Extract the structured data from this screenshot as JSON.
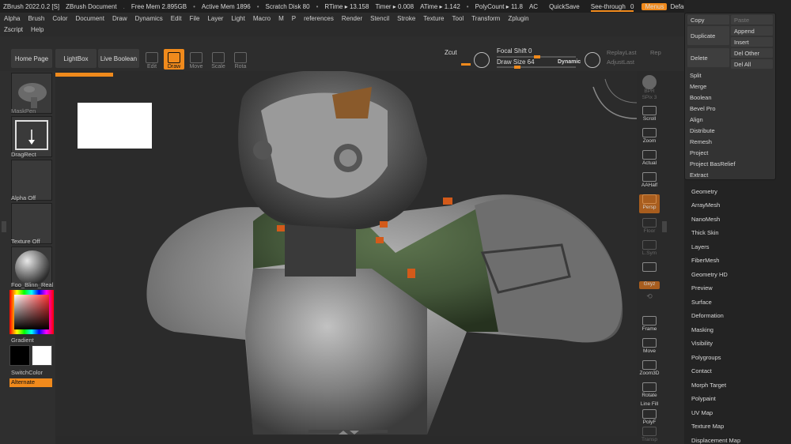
{
  "titlebar": {
    "app": "ZBrush 2022.0.2 [S]",
    "doc": "ZBrush Document",
    "free_mem": "Free Mem 2.895GB",
    "active_mem": "Active Mem 1896",
    "scratch": "Scratch Disk 80",
    "rtime": "RTime ▸ 13.158",
    "timer": "Timer ▸ 0.008",
    "atime": "ATime ▸ 1.142",
    "polycount": "PolyCount ▸ 11.8",
    "ac": "AC",
    "quicksave": "QuickSave",
    "seethrough": "See-through",
    "seethrough_val": "0",
    "menus": "Menus",
    "script": "DefaultZScript"
  },
  "menus": {
    "row1": [
      "Alpha",
      "Brush",
      "Color",
      "Document",
      "Draw",
      "Dynamics",
      "Edit",
      "File",
      "Layer",
      "Light",
      "Macro",
      "M",
      "P",
      "references",
      "Render",
      "Stencil",
      "Stroke",
      "Texture",
      "Tool",
      "Transform",
      "Zplugin"
    ],
    "row2": [
      "Zscript",
      "Help"
    ]
  },
  "toolbar": {
    "home": "Home Page",
    "lightbox": "LightBox",
    "live_boolean": "Live Boolean",
    "edit": "Edit",
    "draw": "Draw",
    "move": "Move",
    "scale": "Scale",
    "rotate": "Rota",
    "zcut": "Zcut",
    "focal_shift": "Focal Shift 0",
    "draw_size": "Draw Size 64",
    "dynamic": "Dynamic",
    "replaylast": "ReplayLast",
    "adjustlast": "AdjustLast",
    "rep": "Rep"
  },
  "leftshelf": {
    "brush": "MaskPen",
    "stroke": "DragRect",
    "alpha": "Alpha Off",
    "texture": "Texture Off",
    "material": "Foo_Blinn_Real",
    "gradient": "Gradient",
    "switchcolor": "SwitchColor",
    "alternate": "Alternate"
  },
  "rightshelf": {
    "bpr": "BPR",
    "spix": "SPix 3",
    "scroll": "Scroll",
    "zoom": "Zoom",
    "actual": "Actual",
    "aahalf": "AAHalf",
    "persp": "Persp",
    "floor": "Floor",
    "lsym": "L.Sym",
    "gxyz": "Gxyz",
    "frame": "Frame",
    "move": "Move",
    "zoom3d": "Zoom3D",
    "rotate": "Rotate",
    "linefill": "Line Fill",
    "polyf": "PolyF",
    "transp": "Transp"
  },
  "subtool": {
    "copy": "Copy",
    "paste": "Paste",
    "duplicate": "Duplicate",
    "append": "Append",
    "insert": "Insert",
    "delete": "Delete",
    "del_other": "Del Other",
    "del_all": "Del All",
    "items": [
      "Split",
      "Merge",
      "Boolean",
      "Bevel Pro",
      "Align",
      "Distribute",
      "Remesh",
      "Project",
      "Project BasRelief",
      "Extract"
    ]
  },
  "palette": [
    "Geometry",
    "ArrayMesh",
    "NanoMesh",
    "Thick Skin",
    "Layers",
    "FiberMesh",
    "Geometry HD",
    "Preview",
    "Surface",
    "Deformation",
    "Masking",
    "Visibility",
    "Polygroups",
    "Contact",
    "Morph Target",
    "Polypaint",
    "UV Map",
    "Texture Map",
    "Displacement Map"
  ],
  "colors": {
    "accent": "#f08a1c",
    "panel": "#2b2b2b",
    "mesh_gray": "#8e8e8e",
    "mesh_green": "#46583a"
  }
}
